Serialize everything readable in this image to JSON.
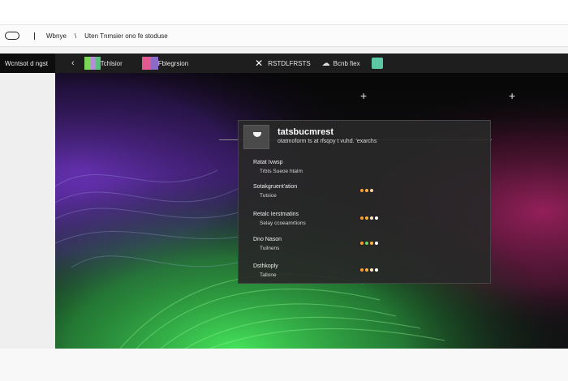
{
  "address_bar": {
    "left_text": "Wbnye",
    "caret": "\\",
    "text": "Uten Tnmsier ono fe stoduse"
  },
  "tabbar": {
    "active_tab": "Wcntsot d ngst",
    "back_glyph": "‹",
    "tab1": "Tchlsior",
    "tab2": "Fblegrsion",
    "close_glyph": "✕",
    "item3": "RSTDLFRSTS",
    "item4": "Bcnb fiex"
  },
  "panel": {
    "title": "tatsbucmrest",
    "subtitle": "otatmoform ts at rfsqoy t vuhd. 'exarchs",
    "rows": [
      {
        "name": "Ratat Ivwsp",
        "value": "Trbts Sueoe htalm",
        "dots": []
      },
      {
        "name": "Sotakgruent'ation",
        "value": "Tutsice",
        "dots": [
          "#ff9b2e",
          "#ffb23f",
          "#ffd2a0"
        ]
      },
      {
        "name": "Retalc Ierstmatins",
        "value": "Selay ccoeamrtions",
        "dots": [
          "#ff9b2e",
          "#ffb23f",
          "#ffe2c0",
          "#ffffff"
        ]
      },
      {
        "name": "Dno Nason",
        "value": "Tuilnens",
        "dots": [
          "#ff9b2e",
          "#6dd65b",
          "#ffb23f",
          "#ffffff"
        ]
      },
      {
        "name": "Dsthkoply",
        "value": "Tallone",
        "dots": [
          "#ff9b2e",
          "#ffb23f",
          "#ffe2c0",
          "#ffffff"
        ]
      }
    ]
  },
  "icons": [
    "pill-icon",
    "back-arrow-icon",
    "close-icon",
    "cloud-icon",
    "puzzle-icon",
    "plus-icon",
    "avatar-icon"
  ],
  "colors": {
    "tabbar": "#1e1e1e",
    "panel": "#282828",
    "accent_orange": "#ff9b2e",
    "accent_green": "#6dd65b"
  }
}
